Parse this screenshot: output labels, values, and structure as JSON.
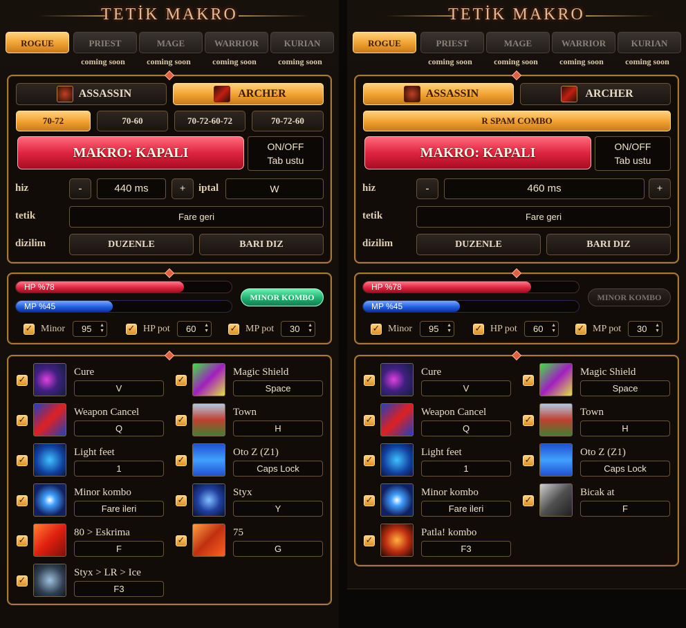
{
  "title": "TETİK MAKRO",
  "tabs": [
    "ROGUE",
    "PRIEST",
    "MAGE",
    "WARRIOR",
    "KURIAN"
  ],
  "coming_soon": "coming soon",
  "left": {
    "class_buttons": [
      "ASSASSIN",
      "ARCHER"
    ],
    "combos": [
      "70-72",
      "70-60",
      "70-72-60-72",
      "70-72-60"
    ],
    "makro_label": "MAKRO: KAPALI",
    "onoff_line1": "ON/OFF",
    "onoff_line2": "Tab ustu",
    "hiz_label": "hiz",
    "minus": "-",
    "plus": "+",
    "speed": "440 ms",
    "iptal_label": "iptal",
    "iptal_value": "W",
    "tetik_label": "tetik",
    "tetik_value": "Fare geri",
    "dizilim_label": "dizilim",
    "duzenle": "DUZENLE",
    "bari_diz": "BARI DIZ",
    "hp_label": "HP  %78",
    "mp_label": "MP  %45",
    "hp_level": 0.78,
    "mp_level": 0.45,
    "minor_kombo": "MINOR KOMBO",
    "minor_label": "Minor",
    "minor_val": "95",
    "hppot_label": "HP pot",
    "hppot_val": "60",
    "mppot_label": "MP pot",
    "mppot_val": "30",
    "skills": [
      {
        "name": "Cure",
        "key": "V",
        "icon": "cure-icon"
      },
      {
        "name": "Magic Shield",
        "key": "Space",
        "icon": "magic-shield-icon"
      },
      {
        "name": "Weapon Cancel",
        "key": "Q",
        "icon": "weapon-cancel-icon"
      },
      {
        "name": "Town",
        "key": "H",
        "icon": "town-icon"
      },
      {
        "name": "Light feet",
        "key": "1",
        "icon": "light-feet-icon"
      },
      {
        "name": "Oto Z (Z1)",
        "key": "Caps Lock",
        "icon": "eyes-icon"
      },
      {
        "name": "Minor kombo",
        "key": "Fare ileri",
        "icon": "minor-kombo-icon"
      },
      {
        "name": "Styx",
        "key": "Y",
        "icon": "styx-icon"
      },
      {
        "name": "80 > Eskrima",
        "key": "F",
        "icon": "eskrima-icon"
      },
      {
        "name": "75",
        "key": "G",
        "icon": "slash-icon"
      },
      {
        "name": "Styx > LR > Ice",
        "key": "F3",
        "icon": "ice-icon"
      }
    ]
  },
  "right": {
    "class_buttons": [
      "ASSASSIN",
      "ARCHER"
    ],
    "combo": "R SPAM COMBO",
    "makro_label": "MAKRO: KAPALI",
    "onoff_line1": "ON/OFF",
    "onoff_line2": "Tab ustu",
    "hiz_label": "hiz",
    "minus": "-",
    "plus": "+",
    "speed": "460 ms",
    "tetik_label": "tetik",
    "tetik_value": "Fare geri",
    "dizilim_label": "dizilim",
    "duzenle": "DUZENLE",
    "bari_diz": "BARI DIZ",
    "hp_label": "HP  %78",
    "mp_label": "MP  %45",
    "hp_level": 0.78,
    "mp_level": 0.45,
    "minor_kombo": "MINOR KOMBO",
    "minor_label": "Minor",
    "minor_val": "95",
    "hppot_label": "HP pot",
    "hppot_val": "60",
    "mppot_label": "MP pot",
    "mppot_val": "30",
    "skills": [
      {
        "name": "Cure",
        "key": "V",
        "icon": "cure-icon"
      },
      {
        "name": "Magic Shield",
        "key": "Space",
        "icon": "magic-shield-icon"
      },
      {
        "name": "Weapon Cancel",
        "key": "Q",
        "icon": "weapon-cancel-icon"
      },
      {
        "name": "Town",
        "key": "H",
        "icon": "town-icon"
      },
      {
        "name": "Light feet",
        "key": "1",
        "icon": "light-feet-icon"
      },
      {
        "name": "Oto Z (Z1)",
        "key": "Caps Lock",
        "icon": "eyes-icon"
      },
      {
        "name": "Minor kombo",
        "key": "Fare ileri",
        "icon": "minor-kombo-icon"
      },
      {
        "name": "Bicak at",
        "key": "F",
        "icon": "dagger-icon"
      },
      {
        "name": "Patla! kombo",
        "key": "F3",
        "icon": "explode-icon"
      }
    ]
  },
  "colors": {
    "accent": "#f0a030",
    "hp": "#e02440",
    "mp": "#2060e0",
    "minor_active": "#20b070"
  }
}
